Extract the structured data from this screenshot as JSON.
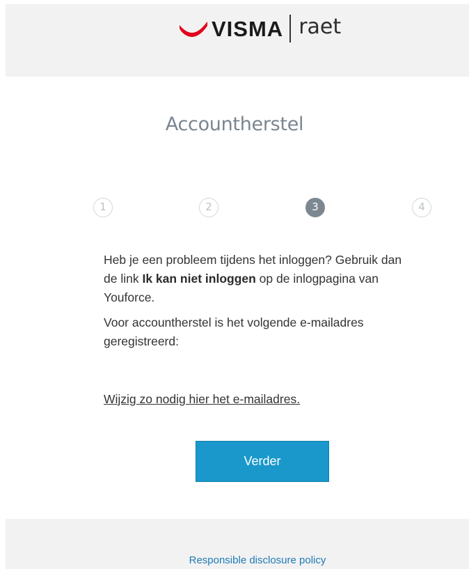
{
  "header": {
    "logo_brand": "VISMA",
    "logo_sub": "raet",
    "brand_color": "#e2001a"
  },
  "title": "Accountherstel",
  "steps": [
    {
      "label": "1",
      "state": "inactive"
    },
    {
      "label": "2",
      "state": "inactive"
    },
    {
      "label": "3",
      "state": "active"
    },
    {
      "label": "4",
      "state": "inactive"
    }
  ],
  "content": {
    "para1_before": "Heb je een probleem tijdens het inloggen? Gebruik dan de link ",
    "para1_bold": "Ik kan niet inloggen",
    "para1_after": " op de inlogpagina van Youforce.",
    "para2": "Voor accountherstel is het volgende e-mailadres geregistreerd:",
    "change_link": "Wijzig zo nodig hier het e-mailadres."
  },
  "actions": {
    "next_label": "Verder",
    "next_color": "#1a98cb"
  },
  "footer": {
    "link": "Responsible disclosure policy"
  }
}
